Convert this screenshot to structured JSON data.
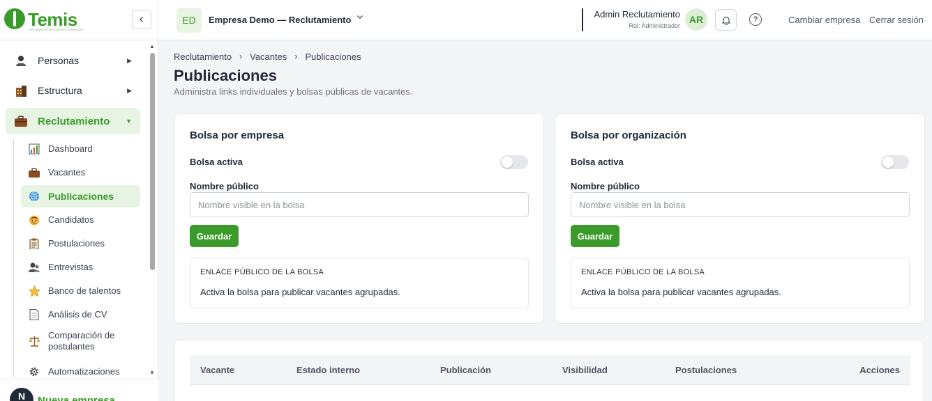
{
  "brand": {
    "name": "Temis",
    "tagline": "SISTEMA DE RECURSOS HUMANOS",
    "color": "#3a9a2a"
  },
  "sidebar": {
    "collapse_icon": "chevron-left-icon",
    "items": [
      {
        "label": "Personas",
        "icon": "person-icon"
      },
      {
        "label": "Estructura",
        "icon": "building-icon"
      },
      {
        "label": "Reclutamiento",
        "icon": "briefcase-icon"
      }
    ],
    "subitems": [
      {
        "label": "Dashboard",
        "icon": "chart-icon"
      },
      {
        "label": "Vacantes",
        "icon": "briefcase-icon"
      },
      {
        "label": "Publicaciones",
        "icon": "globe-icon"
      },
      {
        "label": "Candidatos",
        "icon": "face-icon"
      },
      {
        "label": "Postulaciones",
        "icon": "clipboard-icon"
      },
      {
        "label": "Entrevistas",
        "icon": "interview-icon"
      },
      {
        "label": "Banco de talentos",
        "icon": "star-icon"
      },
      {
        "label": "Análisis de CV",
        "icon": "document-icon"
      },
      {
        "label": "Comparación de postulantes",
        "icon": "scale-icon"
      },
      {
        "label": "Automatizaciones",
        "icon": "gear-icon"
      }
    ],
    "footer": {
      "avatar": "N",
      "label": "Nueva empresa"
    }
  },
  "topbar": {
    "company_badge": "ED",
    "company_name": "Empresa Demo — Reclutamiento",
    "user_name": "Admin Reclutamiento",
    "user_role": "Rol: Administrador",
    "user_initials": "AR",
    "change_company": "Cambiar empresa",
    "logout": "Cerrar sesión"
  },
  "breadcrumb": [
    "Reclutamiento",
    "Vacantes",
    "Publicaciones"
  ],
  "page": {
    "title": "Publicaciones",
    "subtitle": "Administra links individuales y bolsas públicas de vacantes."
  },
  "cards": [
    {
      "title": "Bolsa por empresa",
      "toggle_label": "Bolsa activa",
      "toggle_on": false,
      "field_label": "Nombre público",
      "field_placeholder": "Nombre visible en la bolsa",
      "field_value": "",
      "save_label": "Guardar",
      "link_title": "ENLACE PÚBLICO DE LA BOLSA",
      "link_text": "Activa la bolsa para publicar vacantes agrupadas."
    },
    {
      "title": "Bolsa por organización",
      "toggle_label": "Bolsa activa",
      "toggle_on": false,
      "field_label": "Nombre público",
      "field_placeholder": "Nombre visible en la bolsa",
      "field_value": "",
      "save_label": "Guardar",
      "link_title": "ENLACE PÚBLICO DE LA BOLSA",
      "link_text": "Activa la bolsa para publicar vacantes agrupadas."
    }
  ],
  "table": {
    "columns": [
      "Vacante",
      "Estado interno",
      "Publicación",
      "Visibilidad",
      "Postulaciones",
      "Acciones"
    ]
  }
}
